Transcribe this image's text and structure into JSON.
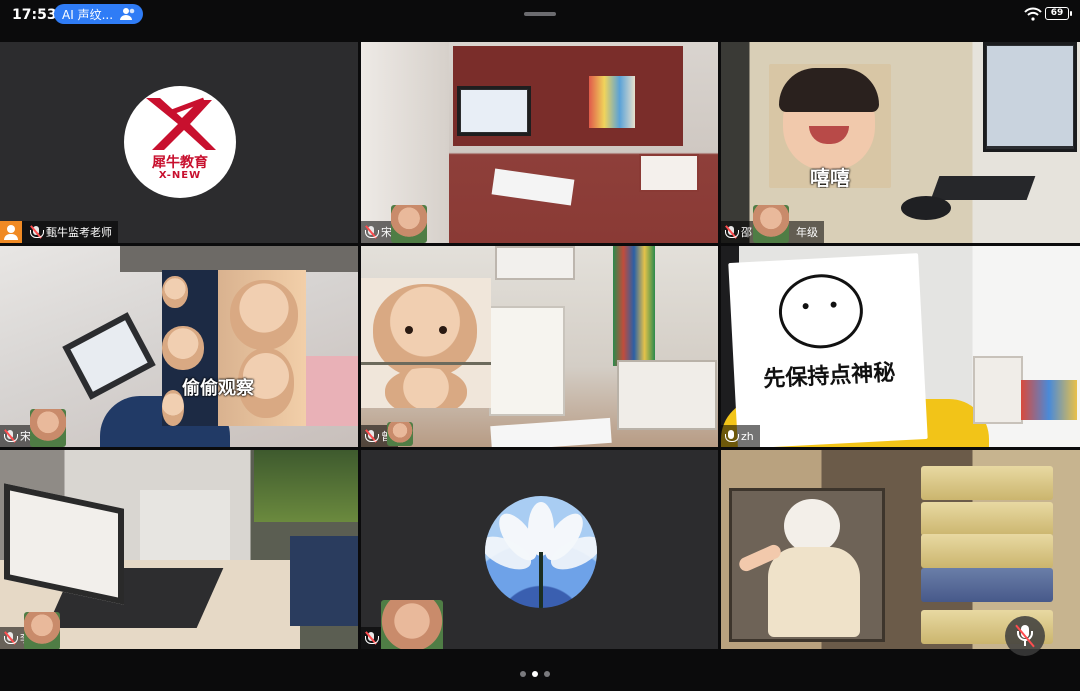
{
  "status_bar": {
    "time": "17:53",
    "ai_pill_label": "AI 声纹...",
    "battery": "69"
  },
  "host_logo": {
    "brand_cn": "犀牛教育",
    "brand_en": "X-NEW",
    "color": "#c8102e"
  },
  "tiles": [
    {
      "label": "甄牛监考老师",
      "mic": "muted",
      "host": true
    },
    {
      "label": "宋",
      "mic": "muted"
    },
    {
      "label": "邵",
      "mic": "muted",
      "label_suffix": "年级"
    },
    {
      "label": "宋",
      "mic": "muted"
    },
    {
      "label": "曾",
      "mic": "muted"
    },
    {
      "label": "zh",
      "mic": "on"
    },
    {
      "label": "李",
      "mic": "muted"
    },
    {
      "label": "",
      "mic": "muted"
    },
    {
      "label": "",
      "mic": "none"
    }
  ],
  "stickers": {
    "kid_text": "嘻嘻",
    "peek_text": "偷偷观察",
    "secret_text": "先保持点神秘"
  },
  "pager": {
    "pages": 3,
    "active": 2
  }
}
